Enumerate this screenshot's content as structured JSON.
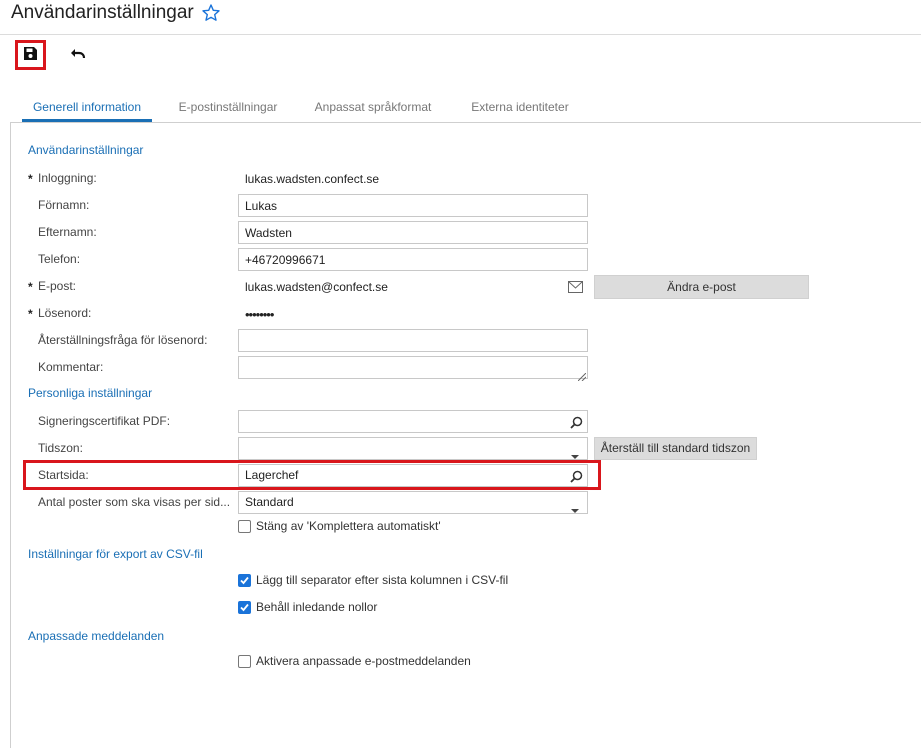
{
  "page": {
    "title": "Användarinställningar"
  },
  "toolbar": {
    "save_icon": "save-icon",
    "undo_icon": "undo-icon"
  },
  "tabs": [
    {
      "label": "Generell information",
      "active": true
    },
    {
      "label": "E-postinställningar",
      "active": false
    },
    {
      "label": "Anpassat språkformat",
      "active": false
    },
    {
      "label": "Externa identiteter",
      "active": false
    }
  ],
  "user_settings": {
    "section_title": "Användarinställningar",
    "login_label": "Inloggning:",
    "login_value": "lukas.wadsten.confect.se",
    "firstname_label": "Förnamn:",
    "firstname_value": "Lukas",
    "lastname_label": "Efternamn:",
    "lastname_value": "Wadsten",
    "phone_label": "Telefon:",
    "phone_value": "+46720996671",
    "email_label": "E-post:",
    "email_value": "lukas.wadsten@confect.se",
    "change_email_button": "Ändra e-post",
    "password_label": "Lösenord:",
    "password_value": "••••••••",
    "reset_question_label": "Återställningsfråga för lösenord:",
    "reset_question_value": "",
    "comment_label": "Kommentar:",
    "comment_value": "",
    "required_marker": "*"
  },
  "personal_settings": {
    "section_title": "Personliga inställningar",
    "signing_cert_label": "Signeringscertifikat PDF:",
    "signing_cert_value": "",
    "timezone_label": "Tidszon:",
    "timezone_value": "",
    "reset_timezone_button": "Återställ till standard tidszon",
    "startpage_label": "Startsida:",
    "startpage_value": "Lagerchef",
    "rows_per_page_label": "Antal poster som ska visas per sid...",
    "rows_per_page_value": "Standard",
    "disable_autocomplete_label": "Stäng av 'Komplettera automatiskt'",
    "disable_autocomplete_checked": false
  },
  "csv_settings": {
    "section_title": "Inställningar för export av CSV-fil",
    "add_separator_label": "Lägg till separator efter sista kolumnen i CSV-fil",
    "add_separator_checked": true,
    "keep_zeros_label": "Behåll inledande nollor",
    "keep_zeros_checked": true
  },
  "custom_messages": {
    "section_title": "Anpassade meddelanden",
    "enable_custom_label": "Aktivera anpassade e-postmeddelanden",
    "enable_custom_checked": false
  },
  "colors": {
    "accent": "#1a6fb5",
    "highlight": "#d9161c",
    "checkbox": "#1a73d9"
  }
}
